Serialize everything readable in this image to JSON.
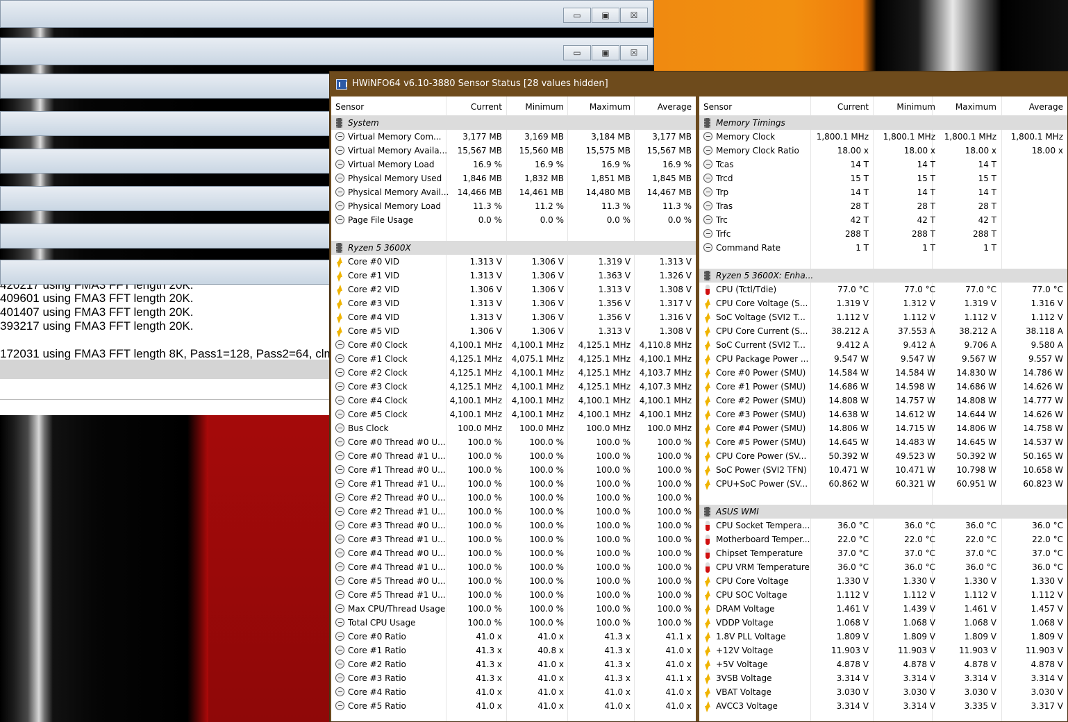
{
  "window": {
    "title": "HWiNFO64 v6.10-3880 Sensor Status [28 values hidden]"
  },
  "background_windows": {
    "controls": {
      "minimize": "▭",
      "maximize": "▣",
      "close": "☒"
    },
    "console_lines": [
      "420217 using FMA3 FFT length 20K.",
      "409601 using FMA3 FFT length 20K.",
      "401407 using FMA3 FFT length 20K.",
      "393217 using FMA3 FFT length 20K.",
      "",
      "172031 using FMA3 FFT length 8K, Pass1=128, Pass2=64, clm="
    ]
  },
  "columns": [
    "Sensor",
    "Current",
    "Minimum",
    "Maximum",
    "Average"
  ],
  "left_rows": [
    {
      "type": "group",
      "name": "System"
    },
    {
      "icon": "clock",
      "name": "Virtual Memory Com...",
      "cur": "3,177 MB",
      "min": "3,169 MB",
      "max": "3,184 MB",
      "avg": "3,177 MB"
    },
    {
      "icon": "clock",
      "name": "Virtual Memory Availa...",
      "cur": "15,567 MB",
      "min": "15,560 MB",
      "max": "15,575 MB",
      "avg": "15,567 MB"
    },
    {
      "icon": "clock",
      "name": "Virtual Memory Load",
      "cur": "16.9 %",
      "min": "16.9 %",
      "max": "16.9 %",
      "avg": "16.9 %"
    },
    {
      "icon": "clock",
      "name": "Physical Memory Used",
      "cur": "1,846 MB",
      "min": "1,832 MB",
      "max": "1,851 MB",
      "avg": "1,845 MB"
    },
    {
      "icon": "clock",
      "name": "Physical Memory Avail...",
      "cur": "14,466 MB",
      "min": "14,461 MB",
      "max": "14,480 MB",
      "avg": "14,467 MB"
    },
    {
      "icon": "clock",
      "name": "Physical Memory Load",
      "cur": "11.3 %",
      "min": "11.2 %",
      "max": "11.3 %",
      "avg": "11.3 %"
    },
    {
      "icon": "clock",
      "name": "Page File Usage",
      "cur": "0.0 %",
      "min": "0.0 %",
      "max": "0.0 %",
      "avg": "0.0 %"
    },
    {
      "type": "blank"
    },
    {
      "type": "group",
      "name": "Ryzen 5 3600X"
    },
    {
      "icon": "volt",
      "name": "Core #0 VID",
      "cur": "1.313 V",
      "min": "1.306 V",
      "max": "1.319 V",
      "avg": "1.313 V"
    },
    {
      "icon": "volt",
      "name": "Core #1 VID",
      "cur": "1.313 V",
      "min": "1.306 V",
      "max": "1.363 V",
      "avg": "1.326 V"
    },
    {
      "icon": "volt",
      "name": "Core #2 VID",
      "cur": "1.306 V",
      "min": "1.306 V",
      "max": "1.313 V",
      "avg": "1.308 V"
    },
    {
      "icon": "volt",
      "name": "Core #3 VID",
      "cur": "1.313 V",
      "min": "1.306 V",
      "max": "1.356 V",
      "avg": "1.317 V"
    },
    {
      "icon": "volt",
      "name": "Core #4 VID",
      "cur": "1.313 V",
      "min": "1.306 V",
      "max": "1.356 V",
      "avg": "1.316 V"
    },
    {
      "icon": "volt",
      "name": "Core #5 VID",
      "cur": "1.306 V",
      "min": "1.306 V",
      "max": "1.313 V",
      "avg": "1.308 V"
    },
    {
      "icon": "clock",
      "name": "Core #0 Clock",
      "cur": "4,100.1 MHz",
      "min": "4,100.1 MHz",
      "max": "4,125.1 MHz",
      "avg": "4,110.8 MHz"
    },
    {
      "icon": "clock",
      "name": "Core #1 Clock",
      "cur": "4,125.1 MHz",
      "min": "4,075.1 MHz",
      "max": "4,125.1 MHz",
      "avg": "4,100.1 MHz"
    },
    {
      "icon": "clock",
      "name": "Core #2 Clock",
      "cur": "4,125.1 MHz",
      "min": "4,100.1 MHz",
      "max": "4,125.1 MHz",
      "avg": "4,103.7 MHz"
    },
    {
      "icon": "clock",
      "name": "Core #3 Clock",
      "cur": "4,125.1 MHz",
      "min": "4,100.1 MHz",
      "max": "4,125.1 MHz",
      "avg": "4,107.3 MHz"
    },
    {
      "icon": "clock",
      "name": "Core #4 Clock",
      "cur": "4,100.1 MHz",
      "min": "4,100.1 MHz",
      "max": "4,100.1 MHz",
      "avg": "4,100.1 MHz"
    },
    {
      "icon": "clock",
      "name": "Core #5 Clock",
      "cur": "4,100.1 MHz",
      "min": "4,100.1 MHz",
      "max": "4,100.1 MHz",
      "avg": "4,100.1 MHz"
    },
    {
      "icon": "clock",
      "name": "Bus Clock",
      "cur": "100.0 MHz",
      "min": "100.0 MHz",
      "max": "100.0 MHz",
      "avg": "100.0 MHz"
    },
    {
      "icon": "clock",
      "name": "Core #0 Thread #0 U...",
      "cur": "100.0 %",
      "min": "100.0 %",
      "max": "100.0 %",
      "avg": "100.0 %"
    },
    {
      "icon": "clock",
      "name": "Core #0 Thread #1 U...",
      "cur": "100.0 %",
      "min": "100.0 %",
      "max": "100.0 %",
      "avg": "100.0 %"
    },
    {
      "icon": "clock",
      "name": "Core #1 Thread #0 U...",
      "cur": "100.0 %",
      "min": "100.0 %",
      "max": "100.0 %",
      "avg": "100.0 %"
    },
    {
      "icon": "clock",
      "name": "Core #1 Thread #1 U...",
      "cur": "100.0 %",
      "min": "100.0 %",
      "max": "100.0 %",
      "avg": "100.0 %"
    },
    {
      "icon": "clock",
      "name": "Core #2 Thread #0 U...",
      "cur": "100.0 %",
      "min": "100.0 %",
      "max": "100.0 %",
      "avg": "100.0 %"
    },
    {
      "icon": "clock",
      "name": "Core #2 Thread #1 U...",
      "cur": "100.0 %",
      "min": "100.0 %",
      "max": "100.0 %",
      "avg": "100.0 %"
    },
    {
      "icon": "clock",
      "name": "Core #3 Thread #0 U...",
      "cur": "100.0 %",
      "min": "100.0 %",
      "max": "100.0 %",
      "avg": "100.0 %"
    },
    {
      "icon": "clock",
      "name": "Core #3 Thread #1 U...",
      "cur": "100.0 %",
      "min": "100.0 %",
      "max": "100.0 %",
      "avg": "100.0 %"
    },
    {
      "icon": "clock",
      "name": "Core #4 Thread #0 U...",
      "cur": "100.0 %",
      "min": "100.0 %",
      "max": "100.0 %",
      "avg": "100.0 %"
    },
    {
      "icon": "clock",
      "name": "Core #4 Thread #1 U...",
      "cur": "100.0 %",
      "min": "100.0 %",
      "max": "100.0 %",
      "avg": "100.0 %"
    },
    {
      "icon": "clock",
      "name": "Core #5 Thread #0 U...",
      "cur": "100.0 %",
      "min": "100.0 %",
      "max": "100.0 %",
      "avg": "100.0 %"
    },
    {
      "icon": "clock",
      "name": "Core #5 Thread #1 U...",
      "cur": "100.0 %",
      "min": "100.0 %",
      "max": "100.0 %",
      "avg": "100.0 %"
    },
    {
      "icon": "clock",
      "name": "Max CPU/Thread Usage",
      "cur": "100.0 %",
      "min": "100.0 %",
      "max": "100.0 %",
      "avg": "100.0 %"
    },
    {
      "icon": "clock",
      "name": "Total CPU Usage",
      "cur": "100.0 %",
      "min": "100.0 %",
      "max": "100.0 %",
      "avg": "100.0 %"
    },
    {
      "icon": "clock",
      "name": "Core #0 Ratio",
      "cur": "41.0 x",
      "min": "41.0 x",
      "max": "41.3 x",
      "avg": "41.1 x"
    },
    {
      "icon": "clock",
      "name": "Core #1 Ratio",
      "cur": "41.3 x",
      "min": "40.8 x",
      "max": "41.3 x",
      "avg": "41.0 x"
    },
    {
      "icon": "clock",
      "name": "Core #2 Ratio",
      "cur": "41.3 x",
      "min": "41.0 x",
      "max": "41.3 x",
      "avg": "41.0 x"
    },
    {
      "icon": "clock",
      "name": "Core #3 Ratio",
      "cur": "41.3 x",
      "min": "41.0 x",
      "max": "41.3 x",
      "avg": "41.1 x"
    },
    {
      "icon": "clock",
      "name": "Core #4 Ratio",
      "cur": "41.0 x",
      "min": "41.0 x",
      "max": "41.0 x",
      "avg": "41.0 x"
    },
    {
      "icon": "clock",
      "name": "Core #5 Ratio",
      "cur": "41.0 x",
      "min": "41.0 x",
      "max": "41.0 x",
      "avg": "41.0 x"
    }
  ],
  "right_rows": [
    {
      "type": "group",
      "name": "Memory Timings"
    },
    {
      "icon": "clock",
      "name": "Memory Clock",
      "cur": "1,800.1 MHz",
      "min": "1,800.1 MHz",
      "max": "1,800.1 MHz",
      "avg": "1,800.1 MHz"
    },
    {
      "icon": "clock",
      "name": "Memory Clock Ratio",
      "cur": "18.00 x",
      "min": "18.00 x",
      "max": "18.00 x",
      "avg": "18.00 x"
    },
    {
      "icon": "clock",
      "name": "Tcas",
      "cur": "14 T",
      "min": "14 T",
      "max": "14 T",
      "avg": ""
    },
    {
      "icon": "clock",
      "name": "Trcd",
      "cur": "15 T",
      "min": "15 T",
      "max": "15 T",
      "avg": ""
    },
    {
      "icon": "clock",
      "name": "Trp",
      "cur": "14 T",
      "min": "14 T",
      "max": "14 T",
      "avg": ""
    },
    {
      "icon": "clock",
      "name": "Tras",
      "cur": "28 T",
      "min": "28 T",
      "max": "28 T",
      "avg": ""
    },
    {
      "icon": "clock",
      "name": "Trc",
      "cur": "42 T",
      "min": "42 T",
      "max": "42 T",
      "avg": ""
    },
    {
      "icon": "clock",
      "name": "Trfc",
      "cur": "288 T",
      "min": "288 T",
      "max": "288 T",
      "avg": ""
    },
    {
      "icon": "clock",
      "name": "Command Rate",
      "cur": "1 T",
      "min": "1 T",
      "max": "1 T",
      "avg": ""
    },
    {
      "type": "blank"
    },
    {
      "type": "group",
      "name": "Ryzen 5 3600X: Enha..."
    },
    {
      "icon": "temp",
      "name": "CPU (Tctl/Tdie)",
      "cur": "77.0 °C",
      "min": "77.0 °C",
      "max": "77.0 °C",
      "avg": "77.0 °C"
    },
    {
      "icon": "volt",
      "name": "CPU Core Voltage (S...",
      "cur": "1.319 V",
      "min": "1.312 V",
      "max": "1.319 V",
      "avg": "1.316 V"
    },
    {
      "icon": "volt",
      "name": "SoC Voltage (SVI2 T...",
      "cur": "1.112 V",
      "min": "1.112 V",
      "max": "1.112 V",
      "avg": "1.112 V"
    },
    {
      "icon": "volt",
      "name": "CPU Core Current (S...",
      "cur": "38.212 A",
      "min": "37.553 A",
      "max": "38.212 A",
      "avg": "38.118 A"
    },
    {
      "icon": "volt",
      "name": "SoC Current (SVI2 T...",
      "cur": "9.412 A",
      "min": "9.412 A",
      "max": "9.706 A",
      "avg": "9.580 A"
    },
    {
      "icon": "volt",
      "name": "CPU Package Power ...",
      "cur": "9.547 W",
      "min": "9.547 W",
      "max": "9.567 W",
      "avg": "9.557 W"
    },
    {
      "icon": "volt",
      "name": "Core #0 Power (SMU)",
      "cur": "14.584 W",
      "min": "14.584 W",
      "max": "14.830 W",
      "avg": "14.786 W"
    },
    {
      "icon": "volt",
      "name": "Core #1 Power (SMU)",
      "cur": "14.686 W",
      "min": "14.598 W",
      "max": "14.686 W",
      "avg": "14.626 W"
    },
    {
      "icon": "volt",
      "name": "Core #2 Power (SMU)",
      "cur": "14.808 W",
      "min": "14.757 W",
      "max": "14.808 W",
      "avg": "14.777 W"
    },
    {
      "icon": "volt",
      "name": "Core #3 Power (SMU)",
      "cur": "14.638 W",
      "min": "14.612 W",
      "max": "14.644 W",
      "avg": "14.626 W"
    },
    {
      "icon": "volt",
      "name": "Core #4 Power (SMU)",
      "cur": "14.806 W",
      "min": "14.715 W",
      "max": "14.806 W",
      "avg": "14.758 W"
    },
    {
      "icon": "volt",
      "name": "Core #5 Power (SMU)",
      "cur": "14.645 W",
      "min": "14.483 W",
      "max": "14.645 W",
      "avg": "14.537 W"
    },
    {
      "icon": "volt",
      "name": "CPU Core Power (SV...",
      "cur": "50.392 W",
      "min": "49.523 W",
      "max": "50.392 W",
      "avg": "50.165 W"
    },
    {
      "icon": "volt",
      "name": "SoC Power (SVI2 TFN)",
      "cur": "10.471 W",
      "min": "10.471 W",
      "max": "10.798 W",
      "avg": "10.658 W"
    },
    {
      "icon": "volt",
      "name": "CPU+SoC Power (SV...",
      "cur": "60.862 W",
      "min": "60.321 W",
      "max": "60.951 W",
      "avg": "60.823 W"
    },
    {
      "type": "blank"
    },
    {
      "type": "group",
      "name": "ASUS WMI"
    },
    {
      "icon": "temp",
      "name": "CPU Socket Tempera...",
      "cur": "36.0 °C",
      "min": "36.0 °C",
      "max": "36.0 °C",
      "avg": "36.0 °C"
    },
    {
      "icon": "temp",
      "name": "Motherboard Temper...",
      "cur": "22.0 °C",
      "min": "22.0 °C",
      "max": "22.0 °C",
      "avg": "22.0 °C"
    },
    {
      "icon": "temp",
      "name": "Chipset Temperature",
      "cur": "37.0 °C",
      "min": "37.0 °C",
      "max": "37.0 °C",
      "avg": "37.0 °C"
    },
    {
      "icon": "temp",
      "name": "CPU VRM Temperature",
      "cur": "36.0 °C",
      "min": "36.0 °C",
      "max": "36.0 °C",
      "avg": "36.0 °C"
    },
    {
      "icon": "volt",
      "name": "CPU Core Voltage",
      "cur": "1.330 V",
      "min": "1.330 V",
      "max": "1.330 V",
      "avg": "1.330 V"
    },
    {
      "icon": "volt",
      "name": "CPU SOC Voltage",
      "cur": "1.112 V",
      "min": "1.112 V",
      "max": "1.112 V",
      "avg": "1.112 V"
    },
    {
      "icon": "volt",
      "name": "DRAM Voltage",
      "cur": "1.461 V",
      "min": "1.439 V",
      "max": "1.461 V",
      "avg": "1.457 V"
    },
    {
      "icon": "volt",
      "name": "VDDP Voltage",
      "cur": "1.068 V",
      "min": "1.068 V",
      "max": "1.068 V",
      "avg": "1.068 V"
    },
    {
      "icon": "volt",
      "name": "1.8V PLL Voltage",
      "cur": "1.809 V",
      "min": "1.809 V",
      "max": "1.809 V",
      "avg": "1.809 V"
    },
    {
      "icon": "volt",
      "name": "+12V Voltage",
      "cur": "11.903 V",
      "min": "11.903 V",
      "max": "11.903 V",
      "avg": "11.903 V"
    },
    {
      "icon": "volt",
      "name": "+5V Voltage",
      "cur": "4.878 V",
      "min": "4.878 V",
      "max": "4.878 V",
      "avg": "4.878 V"
    },
    {
      "icon": "volt",
      "name": "3VSB Voltage",
      "cur": "3.314 V",
      "min": "3.314 V",
      "max": "3.314 V",
      "avg": "3.314 V"
    },
    {
      "icon": "volt",
      "name": "VBAT Voltage",
      "cur": "3.030 V",
      "min": "3.030 V",
      "max": "3.030 V",
      "avg": "3.030 V"
    },
    {
      "icon": "volt",
      "name": "AVCC3 Voltage",
      "cur": "3.314 V",
      "min": "3.314 V",
      "max": "3.335 V",
      "avg": "3.317 V"
    }
  ]
}
